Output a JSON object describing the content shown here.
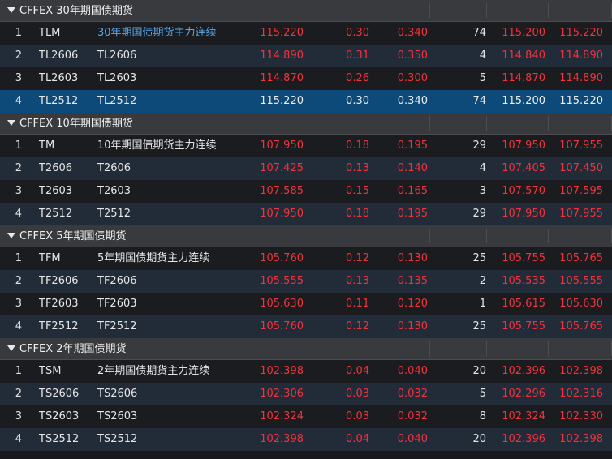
{
  "colors": {
    "up": "#f2323c",
    "link": "#5aa7e8",
    "selected_row": "#0d4a7a",
    "group_header": "#383a3e"
  },
  "icons": {
    "group_toggle": "caret-down-icon"
  },
  "groups": [
    {
      "title": "CFFEX 30年期国债期货",
      "rows": [
        {
          "idx": "1",
          "code": "TLM",
          "name": "30年期国债期货主力连续",
          "price": "115.220",
          "chg": "0.30",
          "pct": "0.340",
          "vol": "74",
          "bid": "115.200",
          "ask": "115.220",
          "state": "up",
          "name_link": true
        },
        {
          "idx": "2",
          "code": "TL2606",
          "name": "TL2606",
          "price": "114.890",
          "chg": "0.31",
          "pct": "0.350",
          "vol": "4",
          "bid": "114.840",
          "ask": "114.890",
          "state": "up"
        },
        {
          "idx": "3",
          "code": "TL2603",
          "name": "TL2603",
          "price": "114.870",
          "chg": "0.26",
          "pct": "0.300",
          "vol": "5",
          "bid": "114.870",
          "ask": "114.890",
          "state": "up"
        },
        {
          "idx": "4",
          "code": "TL2512",
          "name": "TL2512",
          "price": "115.220",
          "chg": "0.30",
          "pct": "0.340",
          "vol": "74",
          "bid": "115.200",
          "ask": "115.220",
          "state": "flat",
          "selected": true
        }
      ]
    },
    {
      "title": "CFFEX 10年期国债期货",
      "rows": [
        {
          "idx": "1",
          "code": "TM",
          "name": "10年期国债期货主力连续",
          "price": "107.950",
          "chg": "0.18",
          "pct": "0.195",
          "vol": "29",
          "bid": "107.950",
          "ask": "107.955",
          "state": "up"
        },
        {
          "idx": "2",
          "code": "T2606",
          "name": "T2606",
          "price": "107.425",
          "chg": "0.13",
          "pct": "0.140",
          "vol": "4",
          "bid": "107.405",
          "ask": "107.450",
          "state": "up"
        },
        {
          "idx": "3",
          "code": "T2603",
          "name": "T2603",
          "price": "107.585",
          "chg": "0.15",
          "pct": "0.165",
          "vol": "3",
          "bid": "107.570",
          "ask": "107.595",
          "state": "up"
        },
        {
          "idx": "4",
          "code": "T2512",
          "name": "T2512",
          "price": "107.950",
          "chg": "0.18",
          "pct": "0.195",
          "vol": "29",
          "bid": "107.950",
          "ask": "107.955",
          "state": "up"
        }
      ]
    },
    {
      "title": "CFFEX 5年期国债期货",
      "rows": [
        {
          "idx": "1",
          "code": "TFM",
          "name": "5年期国债期货主力连续",
          "price": "105.760",
          "chg": "0.12",
          "pct": "0.130",
          "vol": "25",
          "bid": "105.755",
          "ask": "105.765",
          "state": "up"
        },
        {
          "idx": "2",
          "code": "TF2606",
          "name": "TF2606",
          "price": "105.555",
          "chg": "0.13",
          "pct": "0.135",
          "vol": "2",
          "bid": "105.535",
          "ask": "105.555",
          "state": "up"
        },
        {
          "idx": "3",
          "code": "TF2603",
          "name": "TF2603",
          "price": "105.630",
          "chg": "0.11",
          "pct": "0.120",
          "vol": "1",
          "bid": "105.615",
          "ask": "105.630",
          "state": "up"
        },
        {
          "idx": "4",
          "code": "TF2512",
          "name": "TF2512",
          "price": "105.760",
          "chg": "0.12",
          "pct": "0.130",
          "vol": "25",
          "bid": "105.755",
          "ask": "105.765",
          "state": "up"
        }
      ]
    },
    {
      "title": "CFFEX 2年期国债期货",
      "rows": [
        {
          "idx": "1",
          "code": "TSM",
          "name": "2年期国债期货主力连续",
          "price": "102.398",
          "chg": "0.04",
          "pct": "0.040",
          "vol": "20",
          "bid": "102.396",
          "ask": "102.398",
          "state": "up"
        },
        {
          "idx": "2",
          "code": "TS2606",
          "name": "TS2606",
          "price": "102.306",
          "chg": "0.03",
          "pct": "0.032",
          "vol": "5",
          "bid": "102.296",
          "ask": "102.316",
          "state": "up"
        },
        {
          "idx": "3",
          "code": "TS2603",
          "name": "TS2603",
          "price": "102.324",
          "chg": "0.03",
          "pct": "0.032",
          "vol": "8",
          "bid": "102.324",
          "ask": "102.330",
          "state": "up"
        },
        {
          "idx": "4",
          "code": "TS2512",
          "name": "TS2512",
          "price": "102.398",
          "chg": "0.04",
          "pct": "0.040",
          "vol": "20",
          "bid": "102.396",
          "ask": "102.398",
          "state": "up"
        }
      ]
    }
  ]
}
